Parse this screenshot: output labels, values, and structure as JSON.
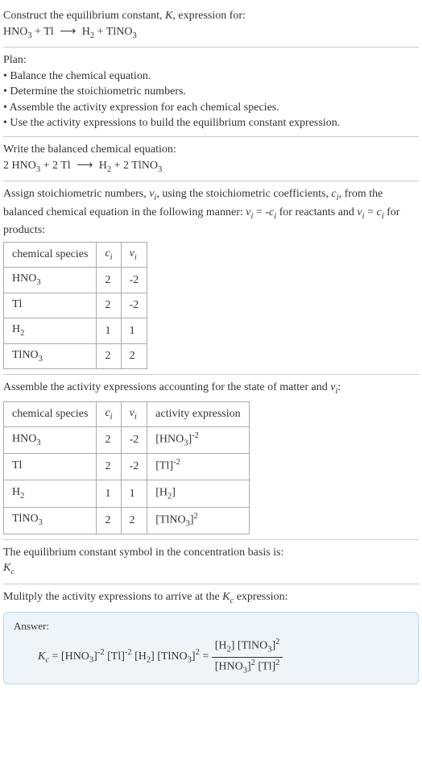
{
  "header": {
    "line1_a": "Construct the equilibrium constant, ",
    "line1_k": "K",
    "line1_b": ", expression for:",
    "reaction_lhs": "HNO",
    "reaction_plus": " + Tl ",
    "reaction_arrow": "⟶",
    "reaction_rhs_a": " H",
    "reaction_rhs_b": " + TlNO"
  },
  "plan": {
    "title": "Plan:",
    "b1": "• Balance the chemical equation.",
    "b2": "• Determine the stoichiometric numbers.",
    "b3": "• Assemble the activity expression for each chemical species.",
    "b4": "• Use the activity expressions to build the equilibrium constant expression."
  },
  "balanced": {
    "title": "Write the balanced chemical equation:",
    "lhs_a": "2 HNO",
    "lhs_b": " + 2 Tl ",
    "arrow": "⟶",
    "rhs_a": " H",
    "rhs_b": " + 2 TlNO"
  },
  "stoich": {
    "text_a": "Assign stoichiometric numbers, ",
    "nu": "ν",
    "i": "i",
    "text_b": ", using the stoichiometric coefficients, ",
    "c": "c",
    "text_c": ", from the balanced chemical equation in the following manner: ",
    "eq1_a": " = -",
    "text_d": " for reactants and ",
    "eq2_a": " = ",
    "text_e": " for products:",
    "hdr1": "chemical species",
    "hdr2_c": "c",
    "hdr2_i": "i",
    "hdr3_nu": "ν",
    "hdr3_i": "i",
    "rows": [
      {
        "species_a": "HNO",
        "species_sub": "3",
        "ci": "2",
        "nui": "-2"
      },
      {
        "species_a": "Tl",
        "species_sub": "",
        "ci": "2",
        "nui": "-2"
      },
      {
        "species_a": "H",
        "species_sub": "2",
        "ci": "1",
        "nui": "1"
      },
      {
        "species_a": "TlNO",
        "species_sub": "3",
        "ci": "2",
        "nui": "2"
      }
    ]
  },
  "activity": {
    "text_a": "Assemble the activity expressions accounting for the state of matter and ",
    "nu": "ν",
    "i": "i",
    "text_b": ":",
    "hdr1": "chemical species",
    "hdr2_c": "c",
    "hdr2_i": "i",
    "hdr3_nu": "ν",
    "hdr3_i": "i",
    "hdr4": "activity expression",
    "rows": [
      {
        "species_a": "HNO",
        "species_sub": "3",
        "ci": "2",
        "nui": "-2",
        "expr_a": "[HNO",
        "expr_sub": "3",
        "expr_b": "]",
        "expr_sup": "-2"
      },
      {
        "species_a": "Tl",
        "species_sub": "",
        "ci": "2",
        "nui": "-2",
        "expr_a": "[Tl]",
        "expr_sub": "",
        "expr_b": "",
        "expr_sup": "-2"
      },
      {
        "species_a": "H",
        "species_sub": "2",
        "ci": "1",
        "nui": "1",
        "expr_a": "[H",
        "expr_sub": "2",
        "expr_b": "]",
        "expr_sup": ""
      },
      {
        "species_a": "TlNO",
        "species_sub": "3",
        "ci": "2",
        "nui": "2",
        "expr_a": "[TlNO",
        "expr_sub": "3",
        "expr_b": "]",
        "expr_sup": "2"
      }
    ]
  },
  "symbol": {
    "text": "The equilibrium constant symbol in the concentration basis is:",
    "K": "K",
    "c": "c"
  },
  "multiply": {
    "text_a": "Mulitply the activity expressions to arrive at the ",
    "K": "K",
    "c": "c",
    "text_b": " expression:"
  },
  "answer": {
    "label": "Answer:",
    "K": "K",
    "c": "c",
    "eq": " = ",
    "t1_a": "[HNO",
    "t1_sub": "3",
    "t1_b": "]",
    "t1_sup": "-2",
    "t2_a": " [Tl]",
    "t2_sup": "-2",
    "t3_a": " [H",
    "t3_sub": "2",
    "t3_b": "] ",
    "t4_a": "[TlNO",
    "t4_sub": "3",
    "t4_b": "]",
    "t4_sup": "2",
    "eq2": " = ",
    "num_a": "[H",
    "num_sub1": "2",
    "num_b": "] [TlNO",
    "num_sub2": "3",
    "num_c": "]",
    "num_sup": "2",
    "den_a": "[HNO",
    "den_sub1": "3",
    "den_b": "]",
    "den_sup1": "2",
    "den_c": " [Tl]",
    "den_sup2": "2"
  }
}
